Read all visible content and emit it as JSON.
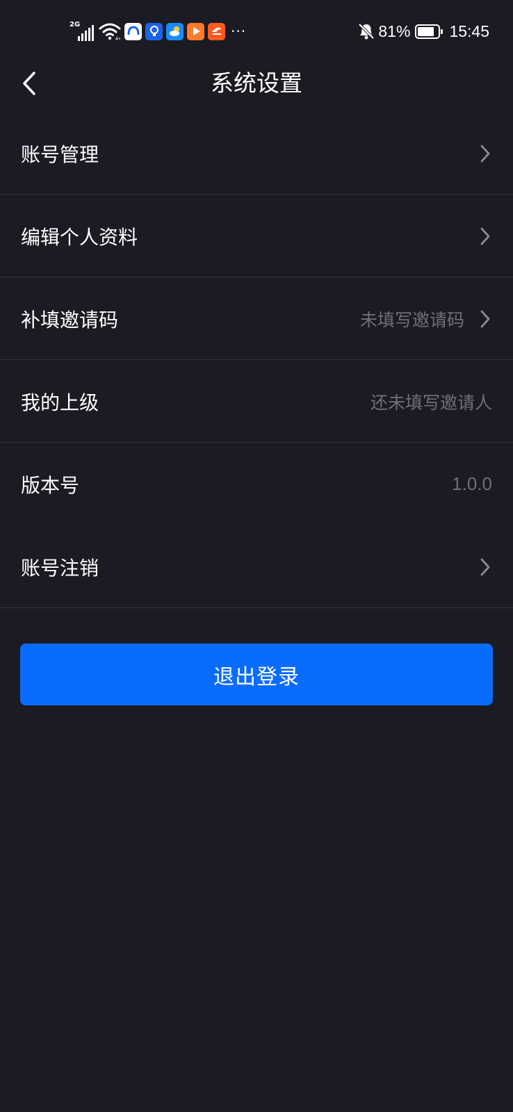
{
  "status_bar": {
    "network_tag": "2G",
    "battery_percent": "81%",
    "battery_level": 0.81,
    "time": "15:45",
    "more": "···",
    "app_icons": [
      {
        "name": "app-icon-1",
        "color": "#ffffff"
      },
      {
        "name": "app-icon-2",
        "color": "#1d63e8"
      },
      {
        "name": "app-icon-3",
        "color": "#1a8cff"
      },
      {
        "name": "app-icon-4",
        "color": "#ff7a2b"
      },
      {
        "name": "app-icon-5",
        "color": "#ff5a1f"
      }
    ]
  },
  "nav": {
    "title": "系统设置",
    "back_icon": "chevron-left-icon"
  },
  "settings": {
    "items": [
      {
        "label": "账号管理",
        "value": "",
        "chevron": true
      },
      {
        "label": "编辑个人资料",
        "value": "",
        "chevron": true
      },
      {
        "label": "补填邀请码",
        "value": "未填写邀请码",
        "chevron": true
      },
      {
        "label": "我的上级",
        "value": "还未填写邀请人",
        "chevron": false
      },
      {
        "label": "版本号",
        "value": "1.0.0",
        "chevron": false
      },
      {
        "label": "账号注销",
        "value": "",
        "chevron": true
      }
    ]
  },
  "logout": {
    "label": "退出登录",
    "color": "#0a6cff"
  },
  "colors": {
    "background": "#1b1b24",
    "divider": "#34343d",
    "secondary_text": "#6f6f77"
  }
}
